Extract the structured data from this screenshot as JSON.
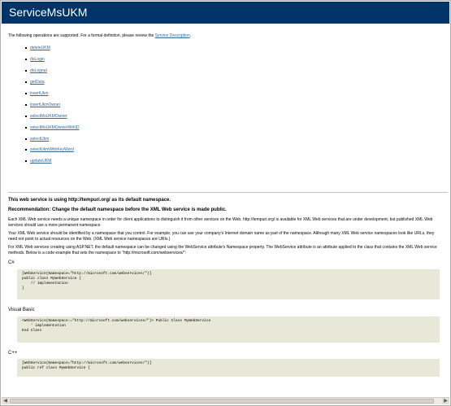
{
  "header": {
    "title": "ServiceMsUKM"
  },
  "intro": {
    "text": "The following operations are supported. For a formal definition, please review the",
    "link": "Service Description",
    "end": "."
  },
  "operations": [
    "deleteUKM",
    "doLogin",
    "doLogout",
    "getData",
    "insertUkm",
    "insertUkmOwner",
    "selectMsUKMOwner",
    "selectMsUKMOwnerWithID",
    "selectUkm",
    "selectUkmWithKeyWord",
    "updateUKM"
  ],
  "namespace": {
    "notice": "This web service is using http://tempuri.org/ as its default namespace.",
    "recommendation": "Recommendation: Change the default namespace before the XML Web service is made public.",
    "p1": "Each XML Web service needs a unique namespace in order for client applications to distinguish it from other services on the Web. http://tempuri.org/ is available for XML Web services that are under development, but published XML Web services should use a more permanent namespace.",
    "p2": "Your XML Web service should be identified by a namespace that you control. For example, you can use your company's Internet domain name as part of the namespace. Although many XML Web service namespaces look like URLs, they need not point to actual resources on the Web. (XML Web service namespaces are URIs.)",
    "p3": "For XML Web services creating using ASP.NET, the default namespace can be changed using the WebService attribute's Namespace property. The WebService attribute is an attribute applied to the class that contains the XML Web service methods. Below is a code example that sets the namespace to \"http://microsoft.com/webservices/\":"
  },
  "code_samples": [
    {
      "language": "C#",
      "code": "[WebService(Namespace=\"http://microsoft.com/webservices/\")]\npublic class MyWebService {\n    // implementation\n}"
    },
    {
      "language": "Visual Basic",
      "code": "<WebService(Namespace:=\"http://microsoft.com/webservices/\")> Public Class MyWebService\n    ' implementation\nEnd Class"
    },
    {
      "language": "C++",
      "code": "[WebService(Namespace=\"http://microsoft.com/webservices/\")]\npublic ref class MyWebService {"
    }
  ],
  "scrollbar": {
    "left_icon": "scroll-left-arrow-icon",
    "right_icon": "scroll-right-arrow-icon"
  }
}
